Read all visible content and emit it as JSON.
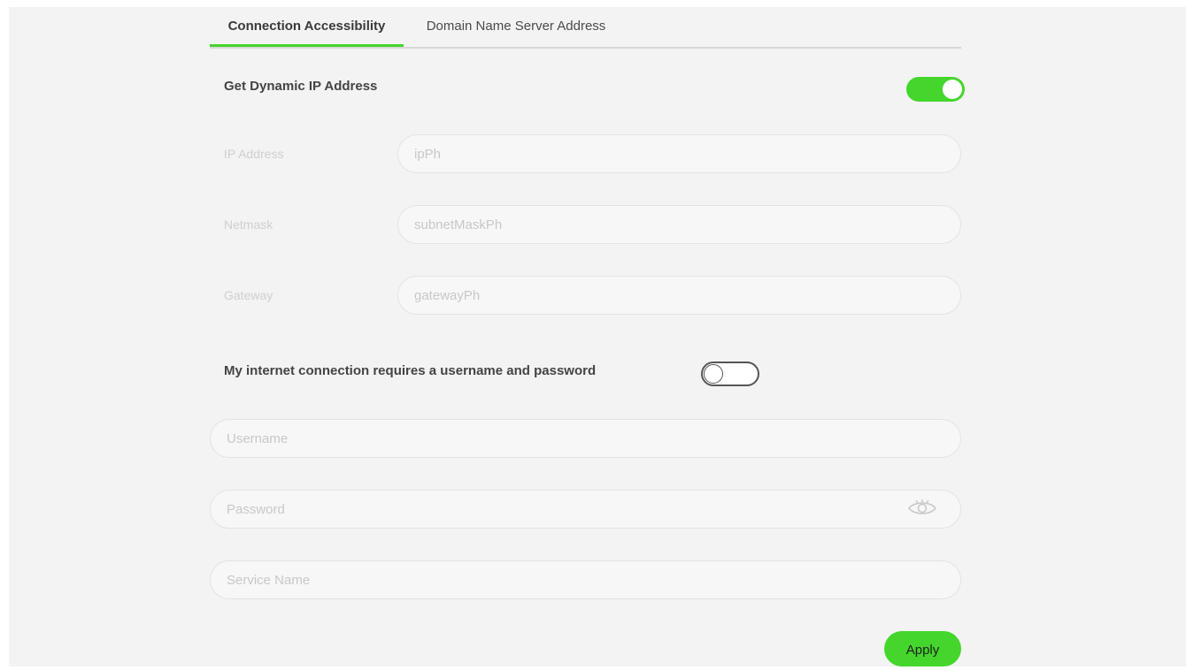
{
  "tabs": [
    {
      "label": "Connection Accessibility",
      "active": true
    },
    {
      "label": "Domain Name Server Address",
      "active": false
    }
  ],
  "dynamic_ip": {
    "label": "Get Dynamic IP Address",
    "enabled": true
  },
  "static_fields": [
    {
      "label": "IP Address",
      "placeholder": "ipPh"
    },
    {
      "label": "Netmask",
      "placeholder": "subnetMaskPh"
    },
    {
      "label": "Gateway",
      "placeholder": "gatewayPh"
    }
  ],
  "auth": {
    "label": "My internet connection requires a username and password",
    "enabled": false,
    "username_placeholder": "Username",
    "password_placeholder": "Password",
    "service_name_placeholder": "Service Name"
  },
  "apply_label": "Apply",
  "icons": {
    "password_visibility": "eye-icon"
  },
  "colors": {
    "accent": "#44d62c",
    "panel_background": "#f3f3f3"
  }
}
